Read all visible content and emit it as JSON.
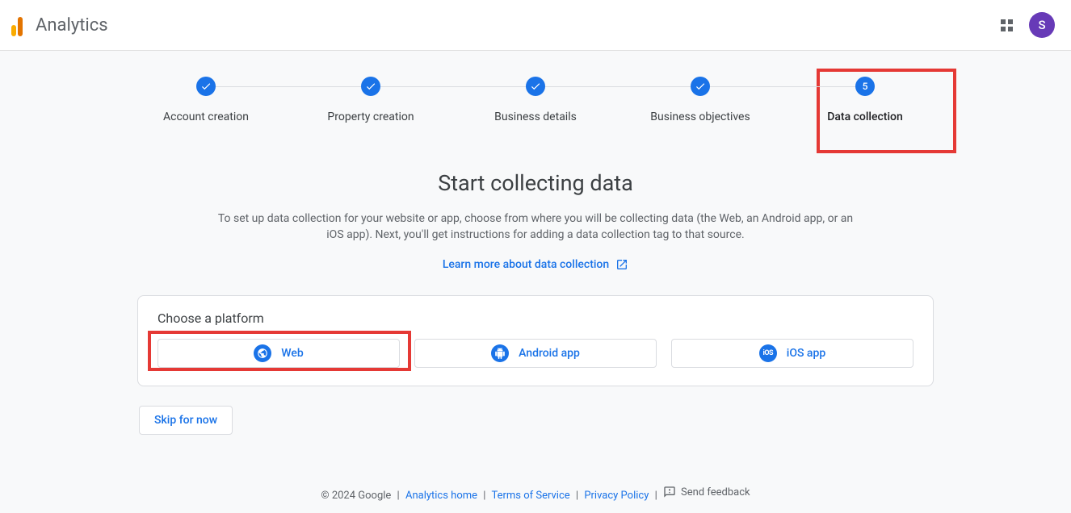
{
  "header": {
    "product_name": "Analytics",
    "avatar_initial": "S"
  },
  "stepper": {
    "steps": [
      {
        "label": "Account creation",
        "state": "done"
      },
      {
        "label": "Property creation",
        "state": "done"
      },
      {
        "label": "Business details",
        "state": "done"
      },
      {
        "label": "Business objectives",
        "state": "done"
      },
      {
        "label": "Data collection",
        "state": "current",
        "number": "5"
      }
    ]
  },
  "content": {
    "title": "Start collecting data",
    "subtitle": "To set up data collection for your website or app, choose from where you will be collecting data (the Web, an Android app, or an iOS app). Next, you'll get instructions for adding a data collection tag to that source.",
    "learn_more": "Learn more about data collection"
  },
  "platform": {
    "section_title": "Choose a platform",
    "options": {
      "web": "Web",
      "android": "Android app",
      "ios": "iOS app"
    }
  },
  "skip_label": "Skip for now",
  "footer": {
    "copyright": "© 2024 Google",
    "links": {
      "home": "Analytics home",
      "terms": "Terms of Service",
      "privacy": "Privacy Policy"
    },
    "feedback": "Send feedback"
  }
}
